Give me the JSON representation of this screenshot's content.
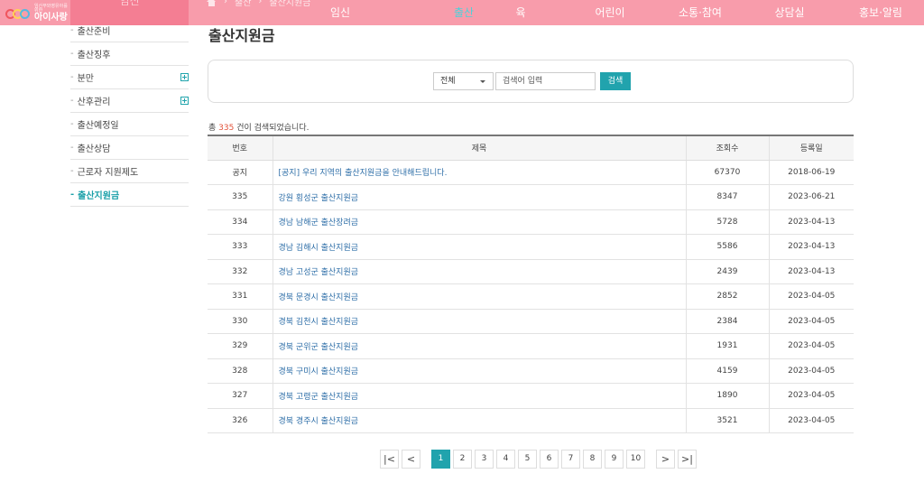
{
  "brand": {
    "sub": "임산부와영유아를위한",
    "main": "아이사랑"
  },
  "side_tab": "임신",
  "breadcrumb": [
    "출산",
    "출산지원금"
  ],
  "nav": [
    {
      "label": "임신",
      "active": false
    },
    {
      "label": "출산",
      "active": true
    },
    {
      "label": "육아",
      "active": false
    },
    {
      "label": "어린이집",
      "active": false
    },
    {
      "label": "소통·참여",
      "active": false
    },
    {
      "label": "상담실",
      "active": false
    },
    {
      "label": "홍보·알림",
      "active": false
    }
  ],
  "sidebar": [
    {
      "label": "출산준비",
      "expand": false,
      "active": false
    },
    {
      "label": "출산징후",
      "expand": false,
      "active": false
    },
    {
      "label": "분만",
      "expand": true,
      "active": false
    },
    {
      "label": "산후관리",
      "expand": true,
      "active": false
    },
    {
      "label": "출산예정일",
      "expand": false,
      "active": false
    },
    {
      "label": "출산상담",
      "expand": false,
      "active": false
    },
    {
      "label": "근로자 지원제도",
      "expand": false,
      "active": false
    },
    {
      "label": "출산지원금",
      "expand": false,
      "active": true
    }
  ],
  "page_title": "출산지원금",
  "search": {
    "select_value": "전체",
    "placeholder": "검색어 입력",
    "button": "검색"
  },
  "result": {
    "prefix": "총",
    "count": "335",
    "suffix": "건이 검색되었습니다."
  },
  "table": {
    "headers": [
      "번호",
      "제목",
      "조회수",
      "등록일"
    ],
    "rows": [
      {
        "no": "공지",
        "title": "[공지] 우리 지역의 출산지원금을 안내해드립니다.",
        "views": "67370",
        "date": "2018-06-19"
      },
      {
        "no": "335",
        "title": "강원 횡성군 출산지원금",
        "views": "8347",
        "date": "2023-06-21"
      },
      {
        "no": "334",
        "title": "경남 남해군 출산장려금",
        "views": "5728",
        "date": "2023-04-13"
      },
      {
        "no": "333",
        "title": "경남 김해시 출산지원금",
        "views": "5586",
        "date": "2023-04-13"
      },
      {
        "no": "332",
        "title": "경남 고성군 출산지원금",
        "views": "2439",
        "date": "2023-04-13"
      },
      {
        "no": "331",
        "title": "경북 문경시 출산지원금",
        "views": "2852",
        "date": "2023-04-05"
      },
      {
        "no": "330",
        "title": "경북 김천시 출산지원금",
        "views": "2384",
        "date": "2023-04-05"
      },
      {
        "no": "329",
        "title": "경북 군위군 출산지원금",
        "views": "1931",
        "date": "2023-04-05"
      },
      {
        "no": "328",
        "title": "경북 구미시 출산지원금",
        "views": "4159",
        "date": "2023-04-05"
      },
      {
        "no": "327",
        "title": "경북 고령군 출산지원금",
        "views": "1890",
        "date": "2023-04-05"
      },
      {
        "no": "326",
        "title": "경북 경주시 출산지원금",
        "views": "3521",
        "date": "2023-04-05"
      }
    ]
  },
  "pagination": {
    "first": "|<",
    "prev": "<",
    "next": ">",
    "last": ">|",
    "pages": [
      "1",
      "2",
      "3",
      "4",
      "5",
      "6",
      "7",
      "8",
      "9",
      "10"
    ],
    "current": "1"
  },
  "colors": {
    "header_bg": "#f89cab",
    "accent": "#21a3ad",
    "link": "#2f6fa8",
    "count": "#e2533b"
  }
}
